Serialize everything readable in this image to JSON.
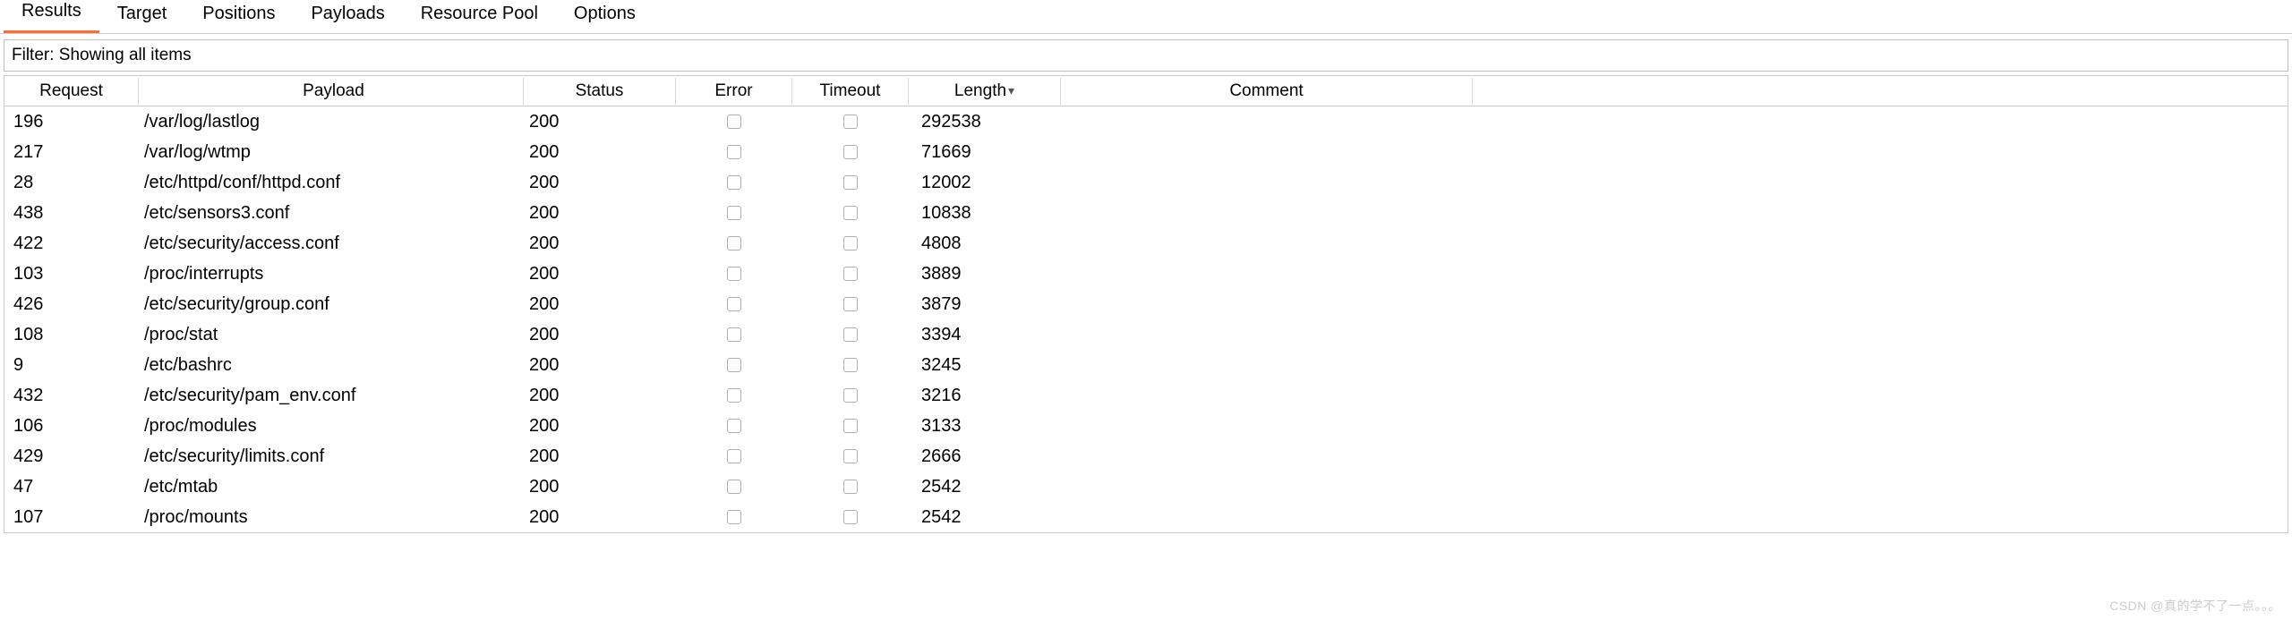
{
  "tabs": [
    {
      "label": "Results",
      "active": true
    },
    {
      "label": "Target",
      "active": false
    },
    {
      "label": "Positions",
      "active": false
    },
    {
      "label": "Payloads",
      "active": false
    },
    {
      "label": "Resource Pool",
      "active": false
    },
    {
      "label": "Options",
      "active": false
    }
  ],
  "filter_text": "Filter: Showing all items",
  "columns": {
    "request": "Request",
    "payload": "Payload",
    "status": "Status",
    "error": "Error",
    "timeout": "Timeout",
    "length": "Length",
    "comment": "Comment"
  },
  "sort_indicator": "▾",
  "rows": [
    {
      "request": "196",
      "payload": "/var/log/lastlog",
      "status": "200",
      "error": false,
      "timeout": false,
      "length": "292538",
      "comment": ""
    },
    {
      "request": "217",
      "payload": "/var/log/wtmp",
      "status": "200",
      "error": false,
      "timeout": false,
      "length": "71669",
      "comment": ""
    },
    {
      "request": "28",
      "payload": "/etc/httpd/conf/httpd.conf",
      "status": "200",
      "error": false,
      "timeout": false,
      "length": "12002",
      "comment": ""
    },
    {
      "request": "438",
      "payload": "/etc/sensors3.conf",
      "status": "200",
      "error": false,
      "timeout": false,
      "length": "10838",
      "comment": ""
    },
    {
      "request": "422",
      "payload": "/etc/security/access.conf",
      "status": "200",
      "error": false,
      "timeout": false,
      "length": "4808",
      "comment": ""
    },
    {
      "request": "103",
      "payload": "/proc/interrupts",
      "status": "200",
      "error": false,
      "timeout": false,
      "length": "3889",
      "comment": ""
    },
    {
      "request": "426",
      "payload": "/etc/security/group.conf",
      "status": "200",
      "error": false,
      "timeout": false,
      "length": "3879",
      "comment": ""
    },
    {
      "request": "108",
      "payload": "/proc/stat",
      "status": "200",
      "error": false,
      "timeout": false,
      "length": "3394",
      "comment": ""
    },
    {
      "request": "9",
      "payload": "/etc/bashrc",
      "status": "200",
      "error": false,
      "timeout": false,
      "length": "3245",
      "comment": ""
    },
    {
      "request": "432",
      "payload": "/etc/security/pam_env.conf",
      "status": "200",
      "error": false,
      "timeout": false,
      "length": "3216",
      "comment": ""
    },
    {
      "request": "106",
      "payload": "/proc/modules",
      "status": "200",
      "error": false,
      "timeout": false,
      "length": "3133",
      "comment": ""
    },
    {
      "request": "429",
      "payload": "/etc/security/limits.conf",
      "status": "200",
      "error": false,
      "timeout": false,
      "length": "2666",
      "comment": ""
    },
    {
      "request": "47",
      "payload": "/etc/mtab",
      "status": "200",
      "error": false,
      "timeout": false,
      "length": "2542",
      "comment": ""
    },
    {
      "request": "107",
      "payload": "/proc/mounts",
      "status": "200",
      "error": false,
      "timeout": false,
      "length": "2542",
      "comment": ""
    }
  ],
  "watermark": "CSDN @真的学不了一点。。。"
}
